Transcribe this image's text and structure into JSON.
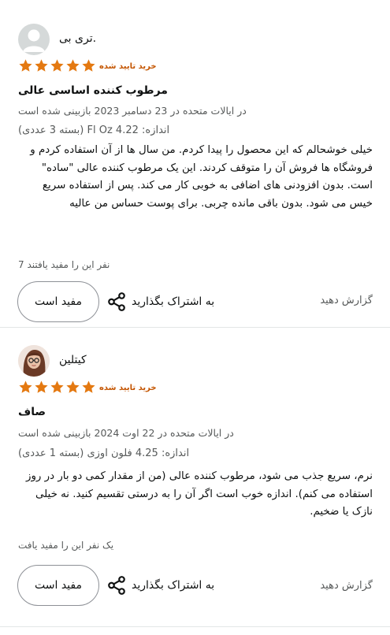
{
  "colors": {
    "star": "#e47911",
    "verified": "#c45500",
    "muted": "#565959",
    "text": "#0f1111"
  },
  "reviews": [
    {
      "author": ".تری بی",
      "rating": 5,
      "verified": "خرید تایید شده",
      "title": "مرطوب کننده اساسی عالی",
      "date": "در ایالات متحده در 23 دسامبر 2023 بازبینی شده است",
      "variant": "(بسته 3 عددی) Fl Oz اندازه: 4.22",
      "body": "خیلی خوشحالم که این محصول را پیدا کردم. من سال ها از آن استفاده کردم و فروشگاه ها فروش آن را متوقف کردند. این یک مرطوب کننده عالی \"ساده\" است. بدون افزودنی های اضافی به خوبی کار می کند. پس از استفاده سریع خیس می شود. بدون باقی مانده چربی. برای پوست حساس من عالیه",
      "helpful_count": "7 نفر این را مفید یافتند",
      "helpful_label": "مفید است",
      "share_label": "به اشتراک بگذارید",
      "report_label": "گزارش دهید"
    },
    {
      "author": "کیتلین",
      "rating": 5,
      "verified": "خرید تایید شده",
      "title": "صاف",
      "date": "در ایالات متحده در 22 اوت 2024 بازبینی شده است",
      "variant": "اندازه: 4.25 فلون اوزی (بسته 1 عددی)",
      "body": "نرم، سریع جذب می شود، مرطوب کننده عالی (من از مقدار کمی دو بار در روز استفاده می کنم). اندازه خوب است اگر آن را به درستی تقسیم کنید. نه خیلی نازک یا ضخیم.",
      "helpful_count": "یک نفر این را مفید یافت",
      "helpful_label": "مفید است",
      "share_label": "به اشتراک بگذارید",
      "report_label": "گزارش دهید"
    }
  ]
}
